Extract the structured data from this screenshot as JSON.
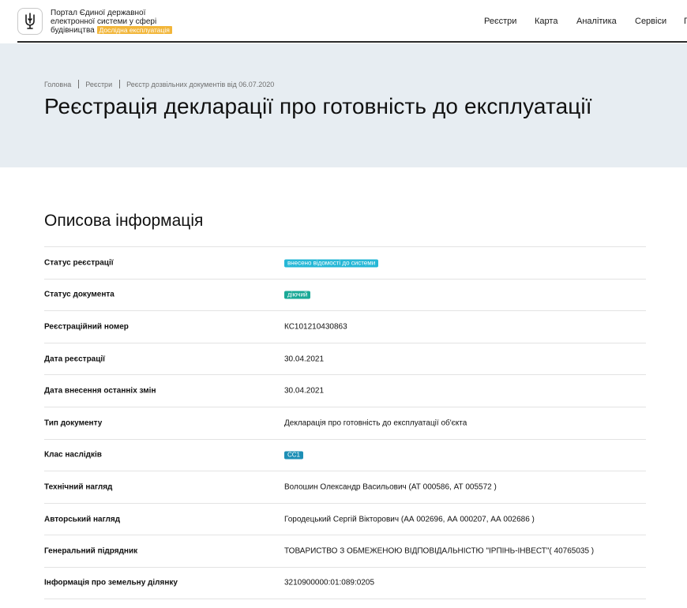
{
  "header": {
    "portal_title": "Портал Єдиної державної електронної системи у сфері будівництва",
    "badge": "Дослідна експлуатація",
    "nav": [
      {
        "label": "Реєстри"
      },
      {
        "label": "Карта"
      },
      {
        "label": "Аналітика"
      },
      {
        "label": "Сервіси"
      },
      {
        "label": "Г"
      }
    ]
  },
  "breadcrumb": [
    "Головна",
    "Реєстри",
    "Реєстр дозвільних документів від 06.07.2020"
  ],
  "page_title": "Реєстрація декларації про готовність до експлуатації",
  "section_title": "Описова інформація",
  "rows": [
    {
      "label": "Статус реєстрації",
      "value": "внесено відомості до системи",
      "tag_color": "#25b7d6"
    },
    {
      "label": "Статус документа",
      "value": "діючий",
      "tag_color": "#1aa997"
    },
    {
      "label": "Реєстраційний номер",
      "value": "КС101210430863"
    },
    {
      "label": "Дата реєстрації",
      "value": "30.04.2021"
    },
    {
      "label": "Дата внесення останніх змін",
      "value": "30.04.2021"
    },
    {
      "label": "Тип документу",
      "value": "Декларація про готовність до експлуатації об'єкта"
    },
    {
      "label": "Клас наслідків",
      "value": "СС1",
      "tag_color": "#1d8fb6"
    },
    {
      "label": "Технічний нагляд",
      "value": "Волошин Олександр Васильович (АТ 000586, АТ 005572 )"
    },
    {
      "label": "Авторський нагляд",
      "value": "Городецький Сергій Вікторович (АА 002696, АА 000207, АА 002686 )"
    },
    {
      "label": "Генеральний підрядник",
      "value": "ТОВАРИСТВО З ОБМЕЖЕНОЮ ВІДПОВІДАЛЬНІСТЮ \"ІРПІНЬ-ІНВЕСТ\"( 40765035 )"
    },
    {
      "label": "Інформація про земельну ділянку",
      "value": "3210900000:01:089:0205"
    }
  ]
}
